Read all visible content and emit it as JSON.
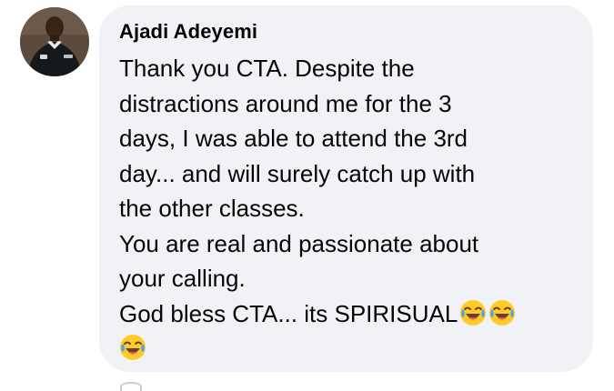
{
  "comment": {
    "author": "Ajadi Adeyemi",
    "lines": [
      "Thank you CTA. Despite the",
      "distractions around me for the 3",
      "days, I was able to attend the 3rd",
      "day... and will surely catch up with",
      "the other classes.",
      "You are real and passionate about",
      "your calling.",
      "God bless CTA... its SPIRISUAL"
    ],
    "emoji_name": "face-with-tears-of-joy",
    "emoji_count": 3
  },
  "colors": {
    "bubble": "#f0f2f5",
    "text": "#050505",
    "emoji_face": "#ffca28",
    "emoji_tear": "#42a5f5"
  }
}
